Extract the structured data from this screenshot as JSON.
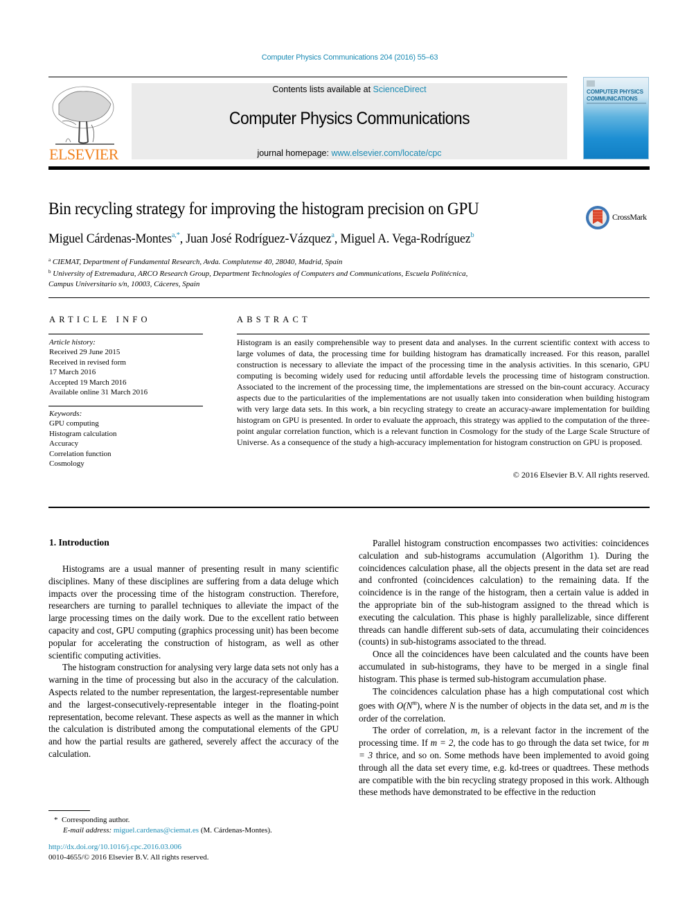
{
  "journal_ref": "Computer Physics Communications 204 (2016) 55–63",
  "header": {
    "publisher": "ELSEVIER",
    "contents_prefix": "Contents lists available at ",
    "contents_link": "ScienceDirect",
    "journal_name": "Computer Physics Communications",
    "homepage_prefix": "journal homepage: ",
    "homepage_link": "www.elsevier.com/locate/cpc",
    "cover_title_line1": "COMPUTER PHYSICS",
    "cover_title_line2": "COMMUNICATIONS",
    "brand_color": "#f07f1a",
    "link_color": "#1a8bb4"
  },
  "article": {
    "title": "Bin recycling strategy for improving the histogram precision on GPU",
    "crossmark_label": "CrossMark",
    "authors": [
      {
        "name": "Miguel Cárdenas-Montes",
        "marks": "a,*"
      },
      {
        "name": "Juan José Rodríguez-Vázquez",
        "marks": "a"
      },
      {
        "name": "Miguel A. Vega-Rodríguez",
        "marks": "b"
      }
    ],
    "affiliations": [
      {
        "mark": "a",
        "text": "CIEMAT, Department of Fundamental Research, Avda. Complutense 40, 28040, Madrid, Spain"
      },
      {
        "mark": "b",
        "text": "University of Extremadura, ARCO Research Group, Department Technologies of Computers and Communications, Escuela Politécnica,",
        "text2": "Campus Universitario s/n, 10003, Cáceres, Spain"
      }
    ]
  },
  "article_info": {
    "caption": "ARTICLE INFO",
    "history_heading": "Article history:",
    "history": [
      "Received 29 June 2015",
      "Received in revised form",
      "17 March 2016",
      "Accepted 19 March 2016",
      "Available online 31 March 2016"
    ],
    "keywords_heading": "Keywords:",
    "keywords": [
      "GPU computing",
      "Histogram calculation",
      "Accuracy",
      "Correlation function",
      "Cosmology"
    ]
  },
  "abstract": {
    "caption": "ABSTRACT",
    "text": "Histogram is an easily comprehensible way to present data and analyses. In the current scientific context with access to large volumes of data, the processing time for building histogram has dramatically increased. For this reason, parallel construction is necessary to alleviate the impact of the processing time in the analysis activities. In this scenario, GPU computing is becoming widely used for reducing until affordable levels the processing time of histogram construction. Associated to the increment of the processing time, the implementations are stressed on the bin-count accuracy. Accuracy aspects due to the particularities of the implementations are not usually taken into consideration when building histogram with very large data sets. In this work, a bin recycling strategy to create an accuracy-aware implementation for building histogram on GPU is presented. In order to evaluate the approach, this strategy was applied to the computation of the three-point angular correlation function, which is a relevant function in Cosmology for the study of the Large Scale Structure of Universe. As a consequence of the study a high-accuracy implementation for histogram construction on GPU is proposed.",
    "copyright": "© 2016 Elsevier B.V. All rights reserved."
  },
  "body": {
    "section_heading": "1.  Introduction",
    "left_paragraphs": [
      "Histograms are a usual manner of presenting result in many scientific disciplines. Many of these disciplines are suffering from a data deluge which impacts over the processing time of the histogram construction. Therefore, researchers are turning to parallel techniques to alleviate the impact of the large processing times on the daily work. Due to the excellent ratio between capacity and cost, GPU computing (graphics processing unit) has been become popular for accelerating the construction of histogram, as well as other scientific computing activities.",
      "The histogram construction for analysing very large data sets not only has a warning in the time of processing but also in the accuracy of the calculation. Aspects related to the number representation, the largest-representable number and the largest-consecutively-representable integer in the floating-point representation, become relevant. These aspects as well as the manner in which the calculation is distributed among the computational elements of the GPU and how the partial results are gathered, severely affect the accuracy of the calculation."
    ],
    "right_paragraphs": [
      "Parallel histogram construction encompasses two activities: coincidences calculation and sub-histograms accumulation (Algorithm 1). During the coincidences calculation phase, all the objects present in the data set are read and confronted (coincidences calculation) to the remaining data. If the coincidence is in the range of the histogram, then a certain value is added in the appropriate bin of the sub-histogram assigned to the thread which is executing the calculation. This phase is highly parallelizable, since different threads can handle different sub-sets of data, accumulating their coincidences (counts) in sub-histograms associated to the thread.",
      "Once all the coincidences have been calculated and the counts have been accumulated in sub-histograms, they have to be merged in a single final histogram. This phase is termed sub-histogram accumulation phase."
    ],
    "p3": {
      "a": "The coincidences calculation phase has a high computational cost which goes with ",
      "math1": "O(N",
      "sup": "m",
      "math1_close": ")",
      "b": ", where ",
      "N": "N",
      "c": " is the number of objects in the data set, and ",
      "m": "m",
      "d": " is the order of the correlation."
    },
    "p4": {
      "a": "The order of correlation, ",
      "m": "m",
      "b": ", is a relevant factor in the increment of the processing time. If ",
      "eq1": "m = 2",
      "c": ", the code has to go through the data set twice, for ",
      "eq2": "m = 3",
      "d": " thrice, and so on. Some methods have been implemented to avoid going through all the data set every time, e.g. kd-trees or quadtrees. These methods are compatible with the bin recycling strategy proposed in this work. Although these methods have demonstrated to be effective in the reduction"
    }
  },
  "footnotes": {
    "star": "*",
    "corresponding": "Corresponding author.",
    "email_label": "E-mail address: ",
    "email": "miguel.cardenas@ciemat.es",
    "email_owner": " (M. Cárdenas-Montes).",
    "doi": "http://dx.doi.org/10.1016/j.cpc.2016.03.006",
    "issn": "0010-4655/© 2016 Elsevier B.V. All rights reserved."
  }
}
